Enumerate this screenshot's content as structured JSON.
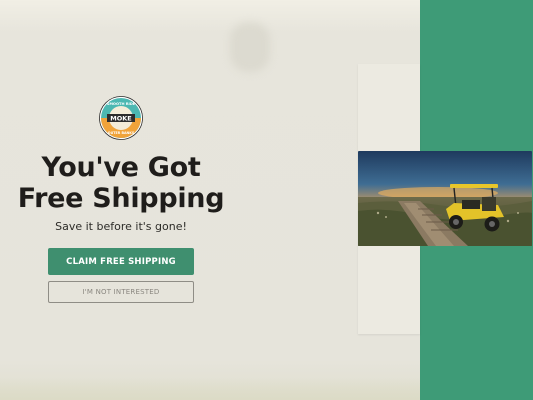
{
  "popup": {
    "logo": {
      "arc_text_top": "SMOOTH RIDE",
      "brand": "MOKE",
      "arc_text_bottom": "OUTER BANKS",
      "icon": "brand-logo-badge"
    },
    "headline_line1": "You've Got",
    "headline_line2": "Free Shipping",
    "subtext": "Save it before it's gone!",
    "claim_button": "CLAIM FREE SHIPPING",
    "decline_button": "I'M NOT INTERESTED"
  },
  "colors": {
    "accent_green": "#3e9b77",
    "button_green": "#3f8f6f",
    "background": "#e7e5dc",
    "headline": "#1f1d1b"
  }
}
